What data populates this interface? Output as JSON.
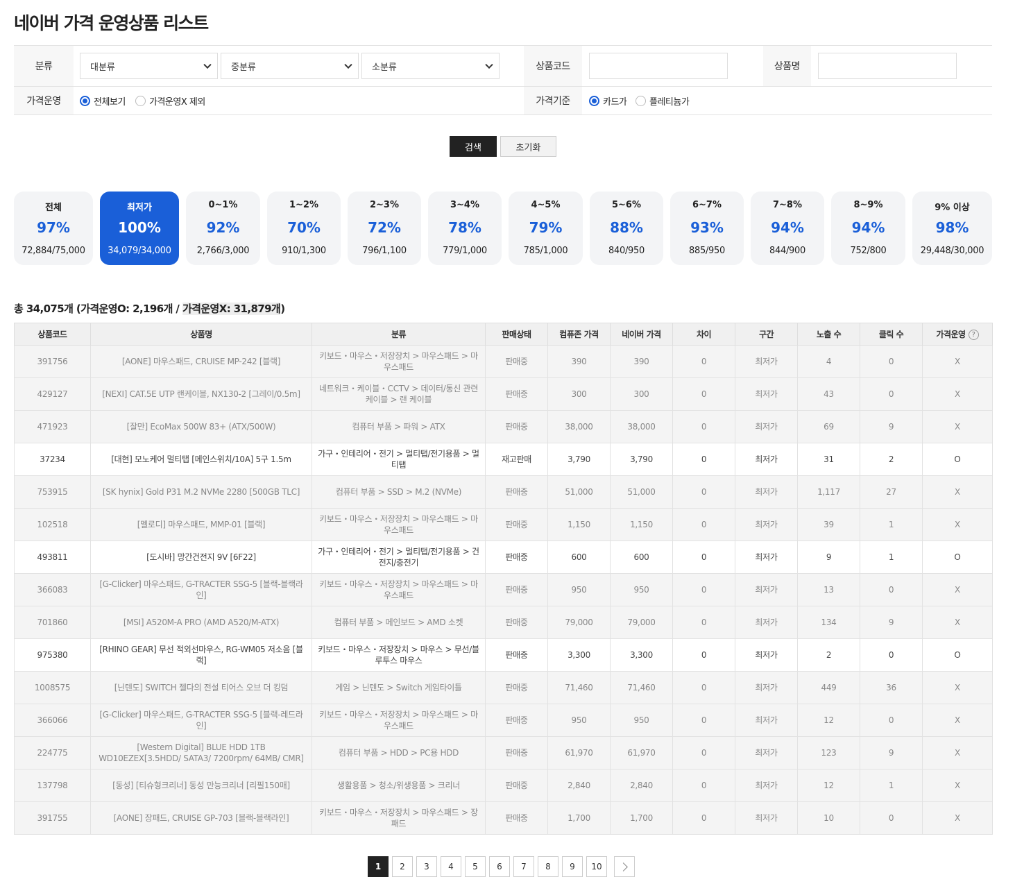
{
  "title": "네이버 가격 운영상품 리스트",
  "filters": {
    "category_label": "분류",
    "cat1": "대분류",
    "cat2": "중분류",
    "cat3": "소분류",
    "code_label": "상품코드",
    "name_label": "상품명",
    "price_op_label": "가격운영",
    "price_op_options": [
      "전체보기",
      "가격운영X 제외"
    ],
    "price_base_label": "가격기준",
    "price_base_options": [
      "카드가",
      "플레티늄가"
    ]
  },
  "buttons": {
    "search": "검색",
    "reset": "초기화"
  },
  "cards": [
    {
      "title": "전체",
      "pct": "97%",
      "count": "72,884/75,000"
    },
    {
      "title": "최저가",
      "pct": "100%",
      "count": "34,079/34,000"
    },
    {
      "title": "0~1%",
      "pct": "92%",
      "count": "2,766/3,000"
    },
    {
      "title": "1~2%",
      "pct": "70%",
      "count": "910/1,300"
    },
    {
      "title": "2~3%",
      "pct": "72%",
      "count": "796/1,100"
    },
    {
      "title": "3~4%",
      "pct": "78%",
      "count": "779/1,000"
    },
    {
      "title": "4~5%",
      "pct": "79%",
      "count": "785/1,000"
    },
    {
      "title": "5~6%",
      "pct": "88%",
      "count": "840/950"
    },
    {
      "title": "6~7%",
      "pct": "93%",
      "count": "885/950"
    },
    {
      "title": "7~8%",
      "pct": "94%",
      "count": "844/900"
    },
    {
      "title": "8~9%",
      "pct": "94%",
      "count": "752/800"
    },
    {
      "title": "9% 이상",
      "pct": "98%",
      "count": "29,448/30,000"
    }
  ],
  "summary": {
    "prefix": "총 34,075개 (가격운영O: 2,196개 / ",
    "highlight": "가격운영X: 31,879개",
    "suffix": ")"
  },
  "table": {
    "headers": [
      "상품코드",
      "상품명",
      "분류",
      "판매상태",
      "컴퓨존 가격",
      "네이버 가격",
      "차이",
      "구간",
      "노출 수",
      "클릭 수",
      "가격운영"
    ],
    "help_icon": "?",
    "rows": [
      [
        "391756",
        "[AONE] 마우스패드, CRUISE MP-242 [블랙]",
        "키보드・마우스・저장장치 > 마우스패드 > 마우스패드",
        "판매중",
        "390",
        "390",
        "0",
        "최저가",
        "4",
        "0",
        "X"
      ],
      [
        "429127",
        "[NEXI] CAT.5E UTP 랜케이블, NX130-2 [그레이/0.5m]",
        "네트워크・케이블・CCTV > 데이터/통신 관련 케이블 > 랜 케이블",
        "판매중",
        "300",
        "300",
        "0",
        "최저가",
        "43",
        "0",
        "X"
      ],
      [
        "471923",
        "[잘만] EcoMax 500W 83+ (ATX/500W)",
        "컴퓨터 부품 > 파워 > ATX",
        "판매중",
        "38,000",
        "38,000",
        "0",
        "최저가",
        "69",
        "9",
        "X"
      ],
      [
        "37234",
        "[대현] 모노케어 멀티탭 [메인스위치/10A] 5구 1.5m",
        "가구・인테리어・전기 > 멀티탭/전기용품 > 멀티탭",
        "재고판매",
        "3,790",
        "3,790",
        "0",
        "최저가",
        "31",
        "2",
        "O"
      ],
      [
        "753915",
        "[SK hynix] Gold P31 M.2 NVMe 2280 [500GB TLC]",
        "컴퓨터 부품 > SSD > M.2 (NVMe)",
        "판매중",
        "51,000",
        "51,000",
        "0",
        "최저가",
        "1,117",
        "27",
        "X"
      ],
      [
        "102518",
        "[멜로디] 마우스패드, MMP-01 [블랙]",
        "키보드・마우스・저장장치 > 마우스패드 > 마우스패드",
        "판매중",
        "1,150",
        "1,150",
        "0",
        "최저가",
        "39",
        "1",
        "X"
      ],
      [
        "493811",
        "[도시바] 망간건전지 9V [6F22]",
        "가구・인테리어・전기 > 멀티탭/전기용품 > 건전지/충전기",
        "판매중",
        "600",
        "600",
        "0",
        "최저가",
        "9",
        "1",
        "O"
      ],
      [
        "366083",
        "[G-Clicker] 마우스패드, G-TRACTER SSG-5 [블랙-블랙라인]",
        "키보드・마우스・저장장치 > 마우스패드 > 마우스패드",
        "판매중",
        "950",
        "950",
        "0",
        "최저가",
        "13",
        "0",
        "X"
      ],
      [
        "701860",
        "[MSI] A520M-A PRO (AMD A520/M-ATX)",
        "컴퓨터 부품 > 메인보드 > AMD 소켓",
        "판매중",
        "79,000",
        "79,000",
        "0",
        "최저가",
        "134",
        "9",
        "X"
      ],
      [
        "975380",
        "[RHINO GEAR] 무선 적외선마우스, RG-WM05 저소음 [블랙]",
        "키보드・마우스・저장장치 > 마우스 > 무선/블루투스 마우스",
        "판매중",
        "3,300",
        "3,300",
        "0",
        "최저가",
        "2",
        "0",
        "O"
      ],
      [
        "1008575",
        "[닌텐도] SWITCH 젤다의 전설 티어스 오브 더 킹덤",
        "게임 > 닌텐도 > Switch 게임타이틀",
        "판매중",
        "71,460",
        "71,460",
        "0",
        "최저가",
        "449",
        "36",
        "X"
      ],
      [
        "366066",
        "[G-Clicker] 마우스패드, G-TRACTER SSG-5 [블랙-레드라인]",
        "키보드・마우스・저장장치 > 마우스패드 > 마우스패드",
        "판매중",
        "950",
        "950",
        "0",
        "최저가",
        "12",
        "0",
        "X"
      ],
      [
        "224775",
        "[Western Digital] BLUE HDD 1TB WD10EZEX[3.5HDD/ SATA3/ 7200rpm/ 64MB/ CMR]",
        "컴퓨터 부품 > HDD > PC용 HDD",
        "판매중",
        "61,970",
        "61,970",
        "0",
        "최저가",
        "123",
        "9",
        "X"
      ],
      [
        "137798",
        "[동성] [티슈형크리너] 동성 만능크리너 [리필150매]",
        "생활용품 > 청소/위생용품 > 크리너",
        "판매중",
        "2,840",
        "2,840",
        "0",
        "최저가",
        "12",
        "1",
        "X"
      ],
      [
        "391755",
        "[AONE] 장패드, CRUISE GP-703 [블랙-블랙라인]",
        "키보드・마우스・저장장치 > 마우스패드 > 장패드",
        "판매중",
        "1,700",
        "1,700",
        "0",
        "최저가",
        "10",
        "0",
        "X"
      ]
    ]
  },
  "pagination": {
    "pages": [
      "1",
      "2",
      "3",
      "4",
      "5",
      "6",
      "7",
      "8",
      "9",
      "10"
    ],
    "current": "1"
  },
  "colors": {
    "accent": "#1a5fd8",
    "dark_button": "#222222"
  }
}
